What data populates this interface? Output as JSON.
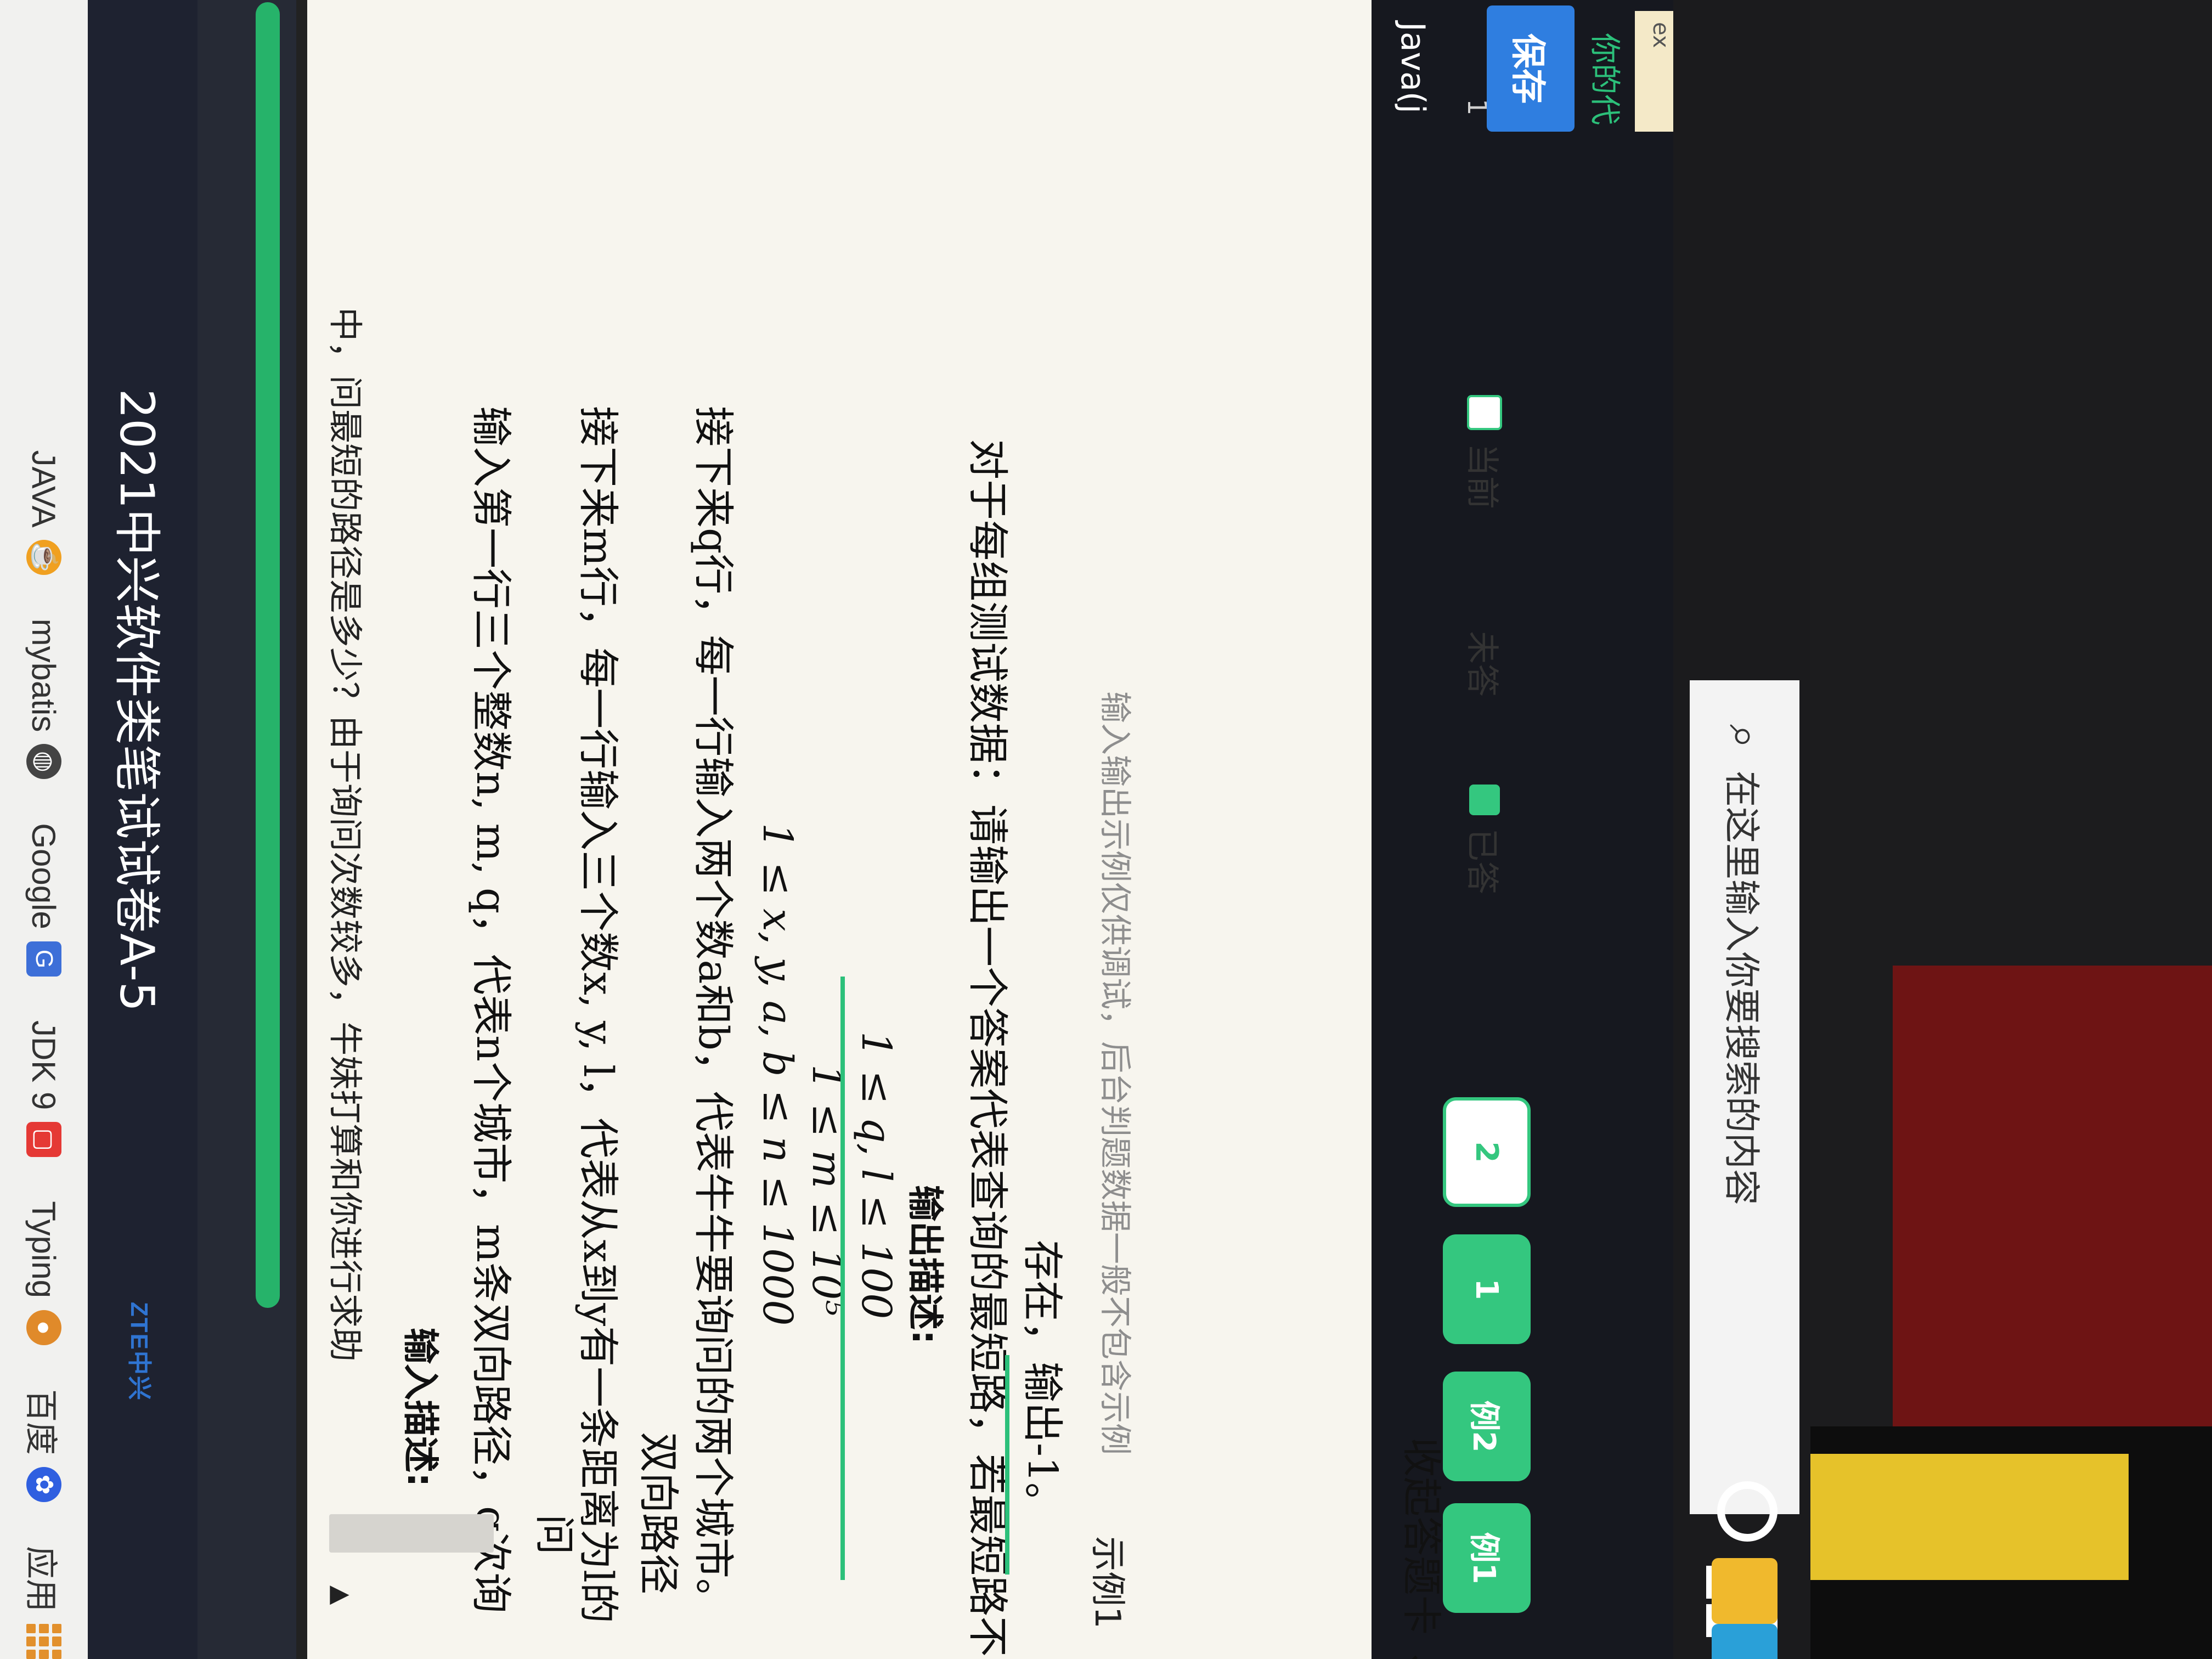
{
  "bookmarks": {
    "items": [
      {
        "label": "应用",
        "icon": "apps-grid-icon"
      },
      {
        "label": "百度",
        "icon": "baidu-paw-icon"
      },
      {
        "label": "Typing",
        "icon": "typing-icon"
      },
      {
        "label": "JDK 9",
        "icon": "jdk-icon"
      },
      {
        "label": "Google",
        "icon": "google-icon"
      },
      {
        "label": "mybatis",
        "icon": "mybatis-icon"
      },
      {
        "label": "JAVA",
        "icon": "java-icon"
      }
    ]
  },
  "header": {
    "logo": "ZTE中兴",
    "title": "2021中兴软件类笔试试卷A-5"
  },
  "question": {
    "cut_off_line": "中，问最短的路径是多少？由于询问次数较多，牛妹打算和你进行求助",
    "input_heading": "输入描述:",
    "input_lines": [
      "输入第一行三个整数n, m, q，代表n个城市，m条双向路径，q次询",
      "问",
      "接下来m行，每一行输入三个数x, y, l，代表从x到y有一条距离为l的",
      "双向路径",
      "接下来q行，每一行输入两个数a和b，代表牛牛要询问的两个城市。",
      "1 ≤ x, y, a, b ≤ n ≤ 1000",
      "1 ≤ m ≤ 10⁵",
      "1 ≤ q, l ≤ 100"
    ],
    "output_heading": "输出描述:",
    "output_lines": [
      "对于每组测试数据：请输出一个答案代表查询的最短路，若最短路不",
      "存在，输出-1。"
    ],
    "example_label": "示例1",
    "note": "输入输出示例仅供调试，后台判题数据一般不包含示例"
  },
  "answer_card": {
    "collapse_label": "收起答题卡 ⌄",
    "buttons": [
      "例1",
      "例2",
      "1",
      "2"
    ],
    "legend": {
      "answered": "已答",
      "unanswered": "未答",
      "current": "当前"
    }
  },
  "editor": {
    "language": "Java(j",
    "line_number": "1",
    "save_label": "保存",
    "your_code": "你的代",
    "example_tab": "ex"
  },
  "taskbar": {
    "search_placeholder": "在这里输入你要搜索的内容"
  },
  "colors": {
    "accent_green": "#34c77f",
    "title_bar": "#1e2230",
    "card_bg": "#f7f5ee"
  }
}
